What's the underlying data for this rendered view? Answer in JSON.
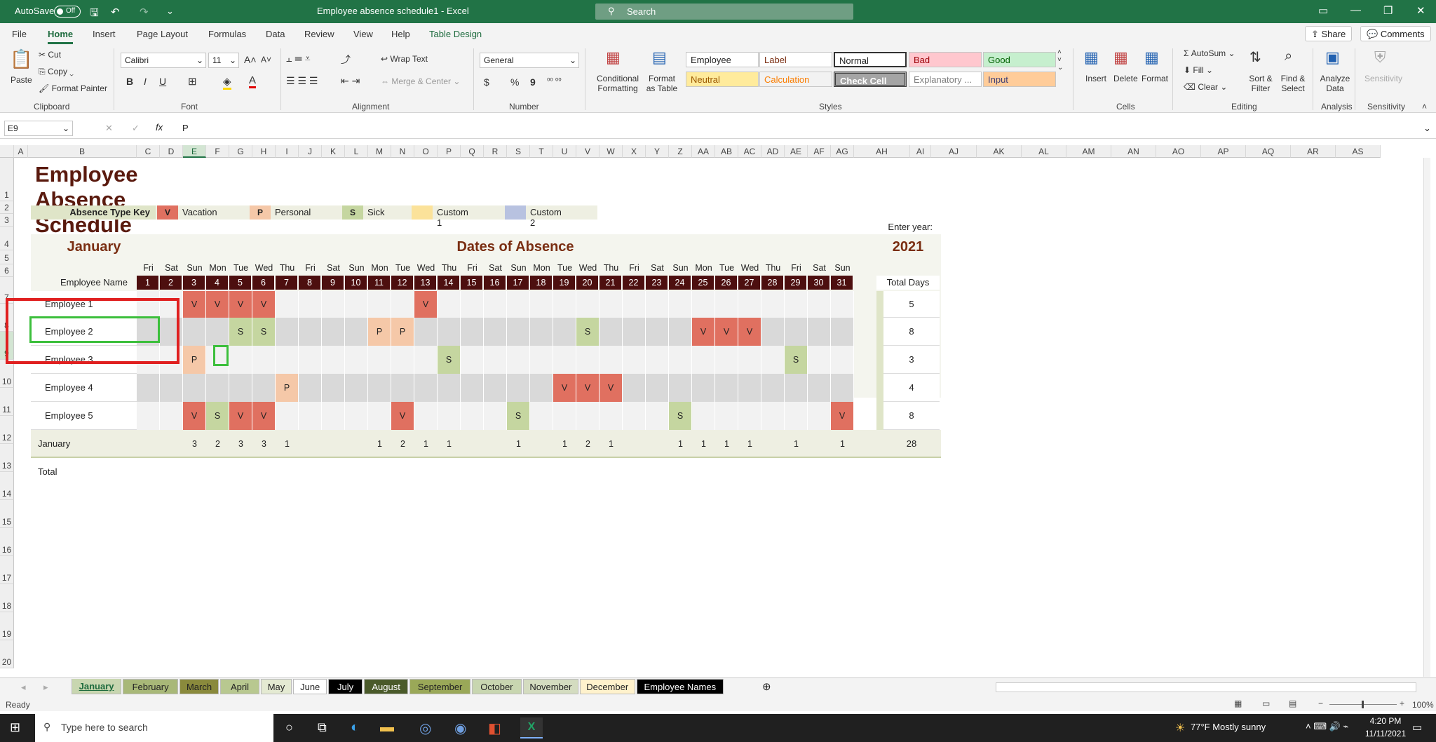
{
  "titlebar": {
    "autosave_label": "AutoSave",
    "autosave_state": "Off",
    "document_title": "Employee absence schedule1  -  Excel",
    "search_placeholder": "Search",
    "minimize": "—",
    "restore": "❐",
    "close": "✕"
  },
  "menu": {
    "items": [
      "File",
      "Home",
      "Insert",
      "Page Layout",
      "Formulas",
      "Data",
      "Review",
      "View",
      "Help",
      "Table Design"
    ],
    "active": "Home",
    "share_label": "Share",
    "comments_label": "Comments"
  },
  "ribbon": {
    "clipboard": {
      "paste": "Paste",
      "cut": "Cut",
      "copy": "Copy",
      "format_painter": "Format Painter",
      "group": "Clipboard"
    },
    "font": {
      "name": "Calibri",
      "size": "11",
      "group": "Font",
      "bold": "B",
      "italic": "I",
      "underline": "U"
    },
    "alignment": {
      "wrap_text": "Wrap Text",
      "merge_center": "Merge & Center",
      "group": "Alignment"
    },
    "number": {
      "format": "General",
      "group": "Number",
      "currency": "$",
      "percent": "%",
      "comma": "9"
    },
    "styles": {
      "conditional": "Conditional Formatting",
      "format_table": "Format as Table",
      "group": "Styles",
      "cells": [
        {
          "label": "Employee",
          "bg": "#ffffff",
          "fg": "#222222"
        },
        {
          "label": "Label",
          "bg": "#ffffff",
          "fg": "#7a2e12"
        },
        {
          "label": "Normal",
          "bg": "#ffffff",
          "fg": "#222222"
        },
        {
          "label": "Bad",
          "bg": "#ffc7ce",
          "fg": "#9c0006"
        },
        {
          "label": "Good",
          "bg": "#c6efce",
          "fg": "#006100"
        },
        {
          "label": "Neutral",
          "bg": "#ffeb9c",
          "fg": "#9c5700"
        },
        {
          "label": "Calculation",
          "bg": "#f2f2f2",
          "fg": "#fa7d00"
        },
        {
          "label": "Check Cell",
          "bg": "#a5a5a5",
          "fg": "#ffffff"
        },
        {
          "label": "Explanatory ...",
          "bg": "#ffffff",
          "fg": "#7f7f7f"
        },
        {
          "label": "Input",
          "bg": "#ffcc99",
          "fg": "#3f3f76"
        }
      ]
    },
    "cells": {
      "insert": "Insert",
      "delete": "Delete",
      "format": "Format",
      "group": "Cells"
    },
    "editing": {
      "autosum": "AutoSum",
      "fill": "Fill",
      "clear": "Clear",
      "sort_filter": "Sort & Filter",
      "find_select": "Find & Select",
      "group": "Editing"
    },
    "analysis": {
      "analyze": "Analyze Data",
      "group": "Analysis"
    },
    "sensitivity": {
      "label": "Sensitivity",
      "group": "Sensitivity"
    }
  },
  "formula_bar": {
    "name_box": "E9",
    "formula": "P",
    "fx": "fx"
  },
  "columns": [
    "A",
    "B",
    "C",
    "D",
    "E",
    "F",
    "G",
    "H",
    "I",
    "J",
    "K",
    "L",
    "M",
    "N",
    "O",
    "P",
    "Q",
    "R",
    "S",
    "T",
    "U",
    "V",
    "W",
    "X",
    "Y",
    "Z",
    "AA",
    "AB",
    "AC",
    "AD",
    "AE",
    "AF",
    "AG",
    "AH",
    "AI",
    "AJ",
    "AK",
    "AL",
    "AM",
    "AN",
    "AO",
    "AP",
    "AQ",
    "AR",
    "AS"
  ],
  "rows": [
    "1",
    "2",
    "3",
    "4",
    "5",
    "6",
    "7",
    "8",
    "9",
    "10",
    "11",
    "12",
    "13",
    "14",
    "15",
    "16",
    "17",
    "18",
    "19",
    "20"
  ],
  "sheet": {
    "title": "Employee Absence Schedule",
    "key_label": "Absence Type Key",
    "key": [
      {
        "code": "V",
        "label": "Vacation",
        "color": "#e07060"
      },
      {
        "code": "P",
        "label": "Personal",
        "color": "#f5c8a8"
      },
      {
        "code": "S",
        "label": "Sick",
        "color": "#c5d6a0"
      },
      {
        "code": "",
        "label": "Custom 1",
        "color": "#fbe29a"
      },
      {
        "code": "",
        "label": "Custom 2",
        "color": "#b8c2e0"
      }
    ],
    "enter_year_label": "Enter year:",
    "month": "January",
    "dates_header": "Dates of Absence",
    "year": "2021",
    "employee_name_header": "Employee Name",
    "total_days_header": "Total Days",
    "weekdays": [
      "Fri",
      "Sat",
      "Sun",
      "Mon",
      "Tue",
      "Wed",
      "Thu",
      "Fri",
      "Sat",
      "Sun",
      "Mon",
      "Tue",
      "Wed",
      "Thu",
      "Fri",
      "Sat",
      "Sun",
      "Mon",
      "Tue",
      "Wed",
      "Thu",
      "Fri",
      "Sat",
      "Sun",
      "Mon",
      "Tue",
      "Wed",
      "Thu",
      "Fri",
      "Sat",
      "Sun"
    ],
    "days": [
      "1",
      "2",
      "3",
      "4",
      "5",
      "6",
      "7",
      "8",
      "9",
      "10",
      "11",
      "12",
      "13",
      "14",
      "15",
      "16",
      "17",
      "18",
      "19",
      "20",
      "21",
      "22",
      "23",
      "24",
      "25",
      "26",
      "27",
      "28",
      "29",
      "30",
      "31"
    ],
    "employees": [
      {
        "name": "Employee 1",
        "absences": {
          "3": "V",
          "4": "V",
          "5": "V",
          "6": "V",
          "13": "V"
        },
        "total": "5"
      },
      {
        "name": "Employee 2",
        "absences": {
          "5": "S",
          "6": "S",
          "11": "P",
          "12": "P",
          "20": "S",
          "25": "V",
          "26": "V",
          "27": "V"
        },
        "total": "8"
      },
      {
        "name": "Employee 3",
        "absences": {
          "3": "P",
          "14": "S",
          "29": "S"
        },
        "total": "3"
      },
      {
        "name": "Employee 4",
        "absences": {
          "7": "P",
          "19": "V",
          "20": "V",
          "21": "V"
        },
        "total": "4"
      },
      {
        "name": "Employee 5",
        "absences": {
          "3": "V",
          "4": "S",
          "5": "V",
          "6": "V",
          "12": "V",
          "17": "S",
          "24": "S",
          "31": "V"
        },
        "total": "8"
      }
    ],
    "total_row_label": "January Total",
    "totals": {
      "3": "3",
      "4": "2",
      "5": "3",
      "6": "3",
      "7": "1",
      "11": "1",
      "12": "2",
      "13": "1",
      "14": "1",
      "17": "1",
      "19": "1",
      "20": "2",
      "21": "1",
      "24": "1",
      "25": "1",
      "26": "1",
      "27": "1",
      "29": "1",
      "31": "1"
    },
    "grand_total": "28"
  },
  "tabs": [
    {
      "label": "January",
      "bg": "#c8d6b0",
      "fg": "#1e6b3e",
      "active": true
    },
    {
      "label": "February",
      "bg": "#a8b878",
      "fg": "#222"
    },
    {
      "label": "March",
      "bg": "#8a8a3c",
      "fg": "#222"
    },
    {
      "label": "April",
      "bg": "#b8c890",
      "fg": "#222"
    },
    {
      "label": "May",
      "bg": "#e4ead2",
      "fg": "#222"
    },
    {
      "label": "June",
      "bg": "#ffffff",
      "fg": "#222"
    },
    {
      "label": "July",
      "bg": "#000000",
      "fg": "#fff"
    },
    {
      "label": "August",
      "bg": "#4a5a2a",
      "fg": "#fff"
    },
    {
      "label": "September",
      "bg": "#9aa858",
      "fg": "#222"
    },
    {
      "label": "October",
      "bg": "#c8d6b0",
      "fg": "#222"
    },
    {
      "label": "November",
      "bg": "#d4dcc0",
      "fg": "#222"
    },
    {
      "label": "December",
      "bg": "#fff2cc",
      "fg": "#222"
    },
    {
      "label": "Employee Names",
      "bg": "#000000",
      "fg": "#fff"
    }
  ],
  "status": {
    "ready": "Ready",
    "zoom": "100%"
  },
  "taskbar": {
    "search": "Type here to search",
    "weather": "77°F  Mostly sunny",
    "time": "4:20 PM",
    "date": "11/11/2021"
  }
}
